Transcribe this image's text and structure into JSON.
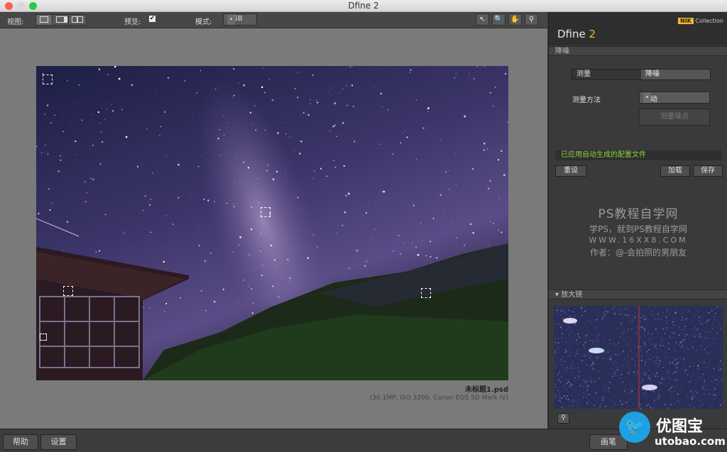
{
  "window": {
    "title": "Dfine 2"
  },
  "toolbar": {
    "view_label": "视图:",
    "preview_label": "预览:",
    "preview_checked": "✔",
    "mode_label": "模式:",
    "mode_value": "RGB",
    "dropdown_glyph": "▾",
    "tools": [
      {
        "name": "select-tool-icon",
        "glyph": "↖"
      },
      {
        "name": "zoom-tool-icon",
        "glyph": "🔍"
      },
      {
        "name": "hand-tool-icon",
        "glyph": "✋"
      },
      {
        "name": "pin-tool-icon",
        "glyph": "⚲"
      }
    ]
  },
  "image": {
    "filename": "未标题1.psd",
    "meta": "(30.1MP, ISO 3200, Canon EOS 5D Mark IV)"
  },
  "panel": {
    "title": "Dfine",
    "title_version": "2",
    "collection_n": "NIK",
    "collection_word": "Collection",
    "noise_section": "降噪",
    "tab_measure": "测量",
    "tab_reduce": "降噪",
    "method_label": "测量方法",
    "method_value": "自动",
    "measure_button": "测量噪点",
    "status": "已应用自动生成的配置文件",
    "reset_button": "重设",
    "load_button": "加载",
    "save_button": "保存",
    "loupe_section": "▾ 放大镜",
    "pin_glyph": "⚲"
  },
  "watermark": {
    "line1": "PS教程自学网",
    "line2": "学PS，就到PS教程自学网",
    "line3": "WWW.16XX8.COM",
    "line4": "作者：@-会拍照的男朋友"
  },
  "bottom": {
    "help": "帮助",
    "settings": "设置",
    "brush": "画笔"
  },
  "brand": {
    "name": "优图宝",
    "url": "utobao.com",
    "bird_glyph": "🐦"
  },
  "colors": {
    "accent": "#f5b731",
    "status_green": "#8fd43a"
  }
}
